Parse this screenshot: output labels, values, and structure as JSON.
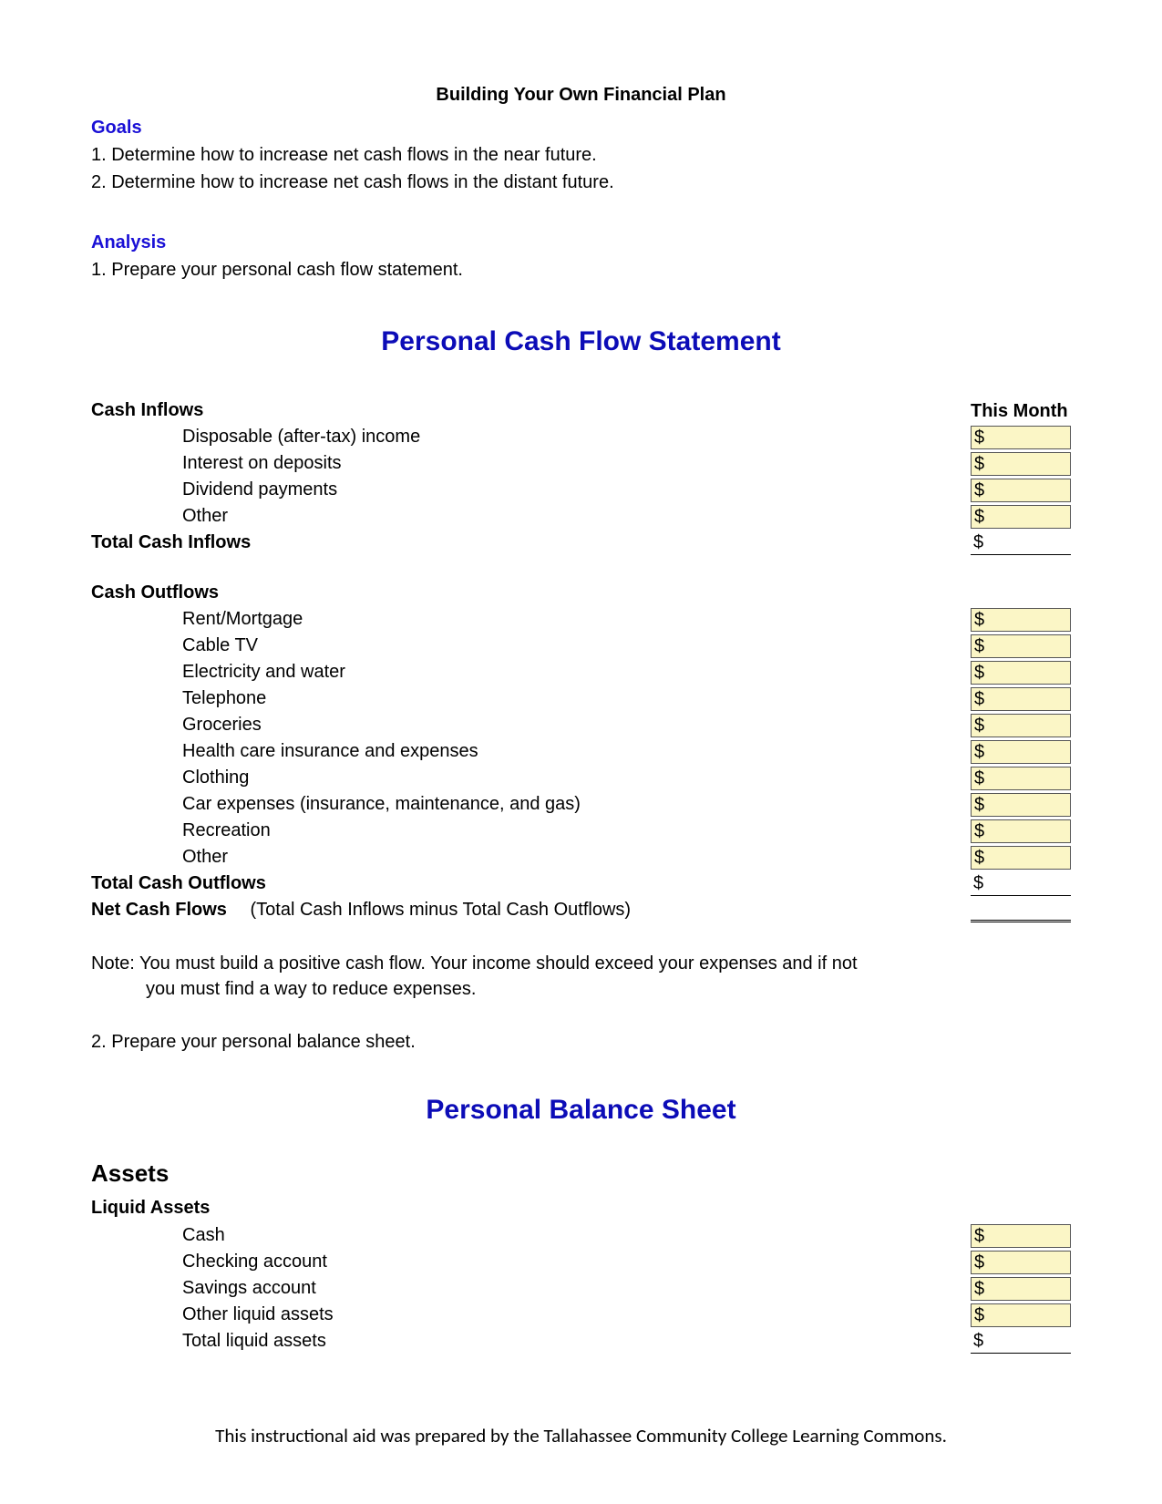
{
  "header": {
    "title": "Building Your Own Financial Plan"
  },
  "goals": {
    "heading": "Goals",
    "items": [
      "1. Determine how to increase net cash flows in the near future.",
      "2. Determine how to increase net cash flows in the distant future."
    ]
  },
  "analysis": {
    "heading": "Analysis",
    "items": [
      "1. Prepare your personal cash flow statement."
    ]
  },
  "statement": {
    "title": "Personal Cash Flow Statement",
    "month_header": "This Month",
    "inflows": {
      "heading": "Cash Inflows",
      "items": [
        "Disposable (after-tax) income",
        "Interest on deposits",
        "Dividend payments",
        "Other"
      ],
      "total_label": "Total Cash Inflows"
    },
    "outflows": {
      "heading": "Cash Outflows",
      "items": [
        "Rent/Mortgage",
        "Cable TV",
        "Electricity and water",
        "Telephone",
        "Groceries",
        "Health care insurance and expenses",
        "Clothing",
        "Car expenses (insurance, maintenance, and gas)",
        "Recreation",
        "Other"
      ],
      "total_label": "Total Cash Outflows"
    },
    "net": {
      "label": "Net Cash Flows",
      "note": "(Total Cash Inflows minus Total Cash Outflows)"
    },
    "note_line1": "Note: You must build a positive cash flow.  Your income should exceed your expenses and if not",
    "note_line2": "you must find a way to reduce expenses."
  },
  "analysis2": "2. Prepare your personal balance sheet.",
  "balance": {
    "title": "Personal Balance Sheet",
    "assets_heading": "Assets",
    "liquid": {
      "heading": "Liquid Assets",
      "items": [
        "Cash",
        "Checking account",
        "Savings account",
        "Other liquid assets"
      ],
      "total_label": "Total liquid assets"
    }
  },
  "dollar": "$",
  "footer": "This instructional aid was prepared by the Tallahassee Community College Learning Commons."
}
